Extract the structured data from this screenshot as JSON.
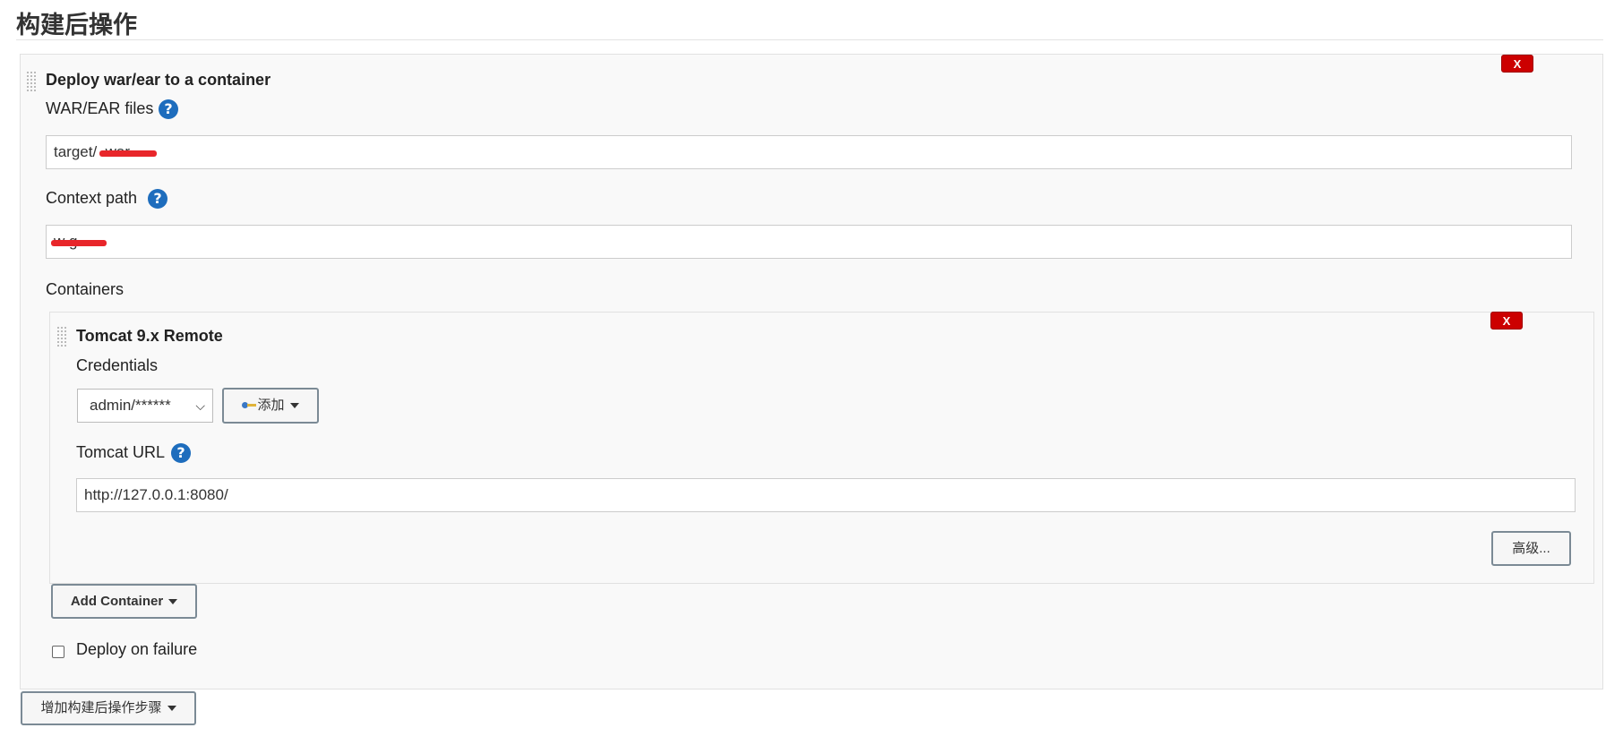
{
  "section": {
    "title": "构建后操作"
  },
  "deploy_step": {
    "heading": "Deploy war/ear to a container",
    "delete_label": "X",
    "war_files": {
      "label": "WAR/EAR files",
      "value": "target/ .war"
    },
    "context_path": {
      "label": "Context path",
      "value": "w g"
    },
    "containers_label": "Containers",
    "container": {
      "heading": "Tomcat 9.x Remote",
      "delete_label": "X",
      "credentials_label": "Credentials",
      "credentials_selected": "admin/******",
      "add_label": "添加",
      "tomcat_url_label": "Tomcat URL",
      "tomcat_url_value": "http://127.0.0.1:8080/",
      "advanced_label": "高级..."
    },
    "add_container_label": "Add Container",
    "deploy_on_failure_label": "Deploy on failure",
    "deploy_on_failure_checked": false
  },
  "add_step_label": "增加构建后操作步骤",
  "help_icon_text": "?",
  "colors": {
    "delete": "#cc0000",
    "help": "#1e6dbd",
    "redaction": "#e8262a"
  }
}
